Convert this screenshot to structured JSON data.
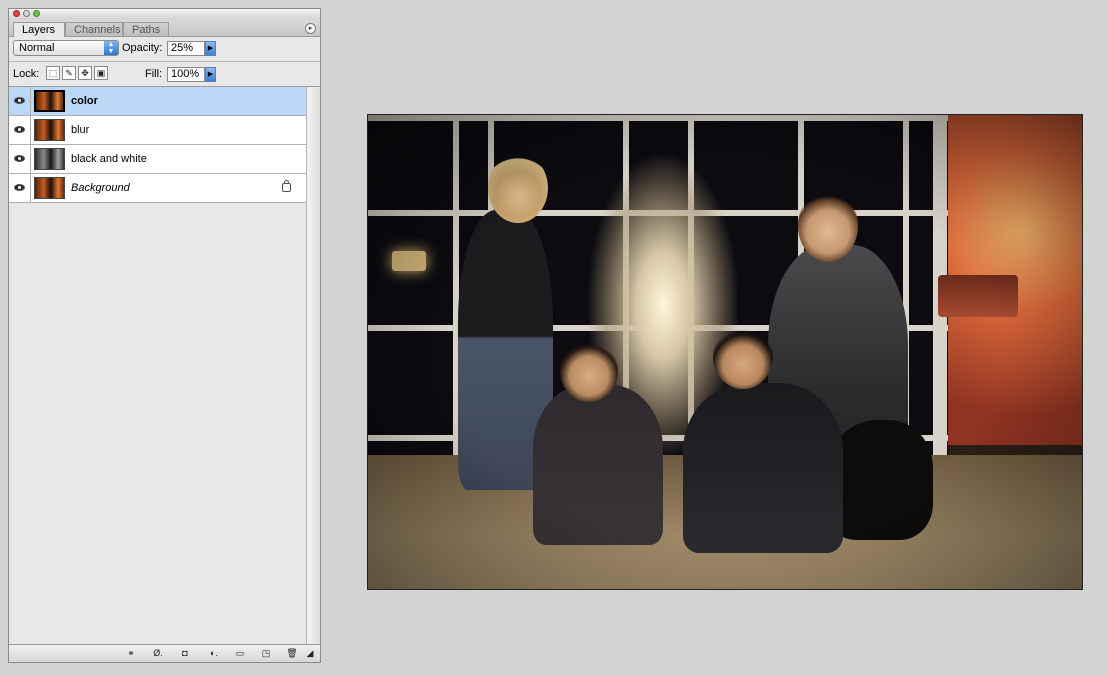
{
  "layers_panel": {
    "tabs": [
      "Layers",
      "Channels",
      "Paths"
    ],
    "blend_mode": "Normal",
    "opacity_label": "Opacity:",
    "opacity_value": "25%",
    "lock_label": "Lock:",
    "fill_label": "Fill:",
    "fill_value": "100%",
    "layers": [
      {
        "name": "color",
        "visible": true,
        "selected": true
      },
      {
        "name": "blur",
        "visible": true,
        "selected": false
      },
      {
        "name": "black and white",
        "visible": true,
        "selected": false
      },
      {
        "name": "Background",
        "visible": true,
        "selected": false,
        "locked": true
      }
    ],
    "bottom_icons": [
      "link-layers-icon",
      "layer-style-icon",
      "layer-mask-icon",
      "adjustment-layer-icon",
      "new-group-icon",
      "new-layer-icon",
      "trash-icon"
    ]
  },
  "canvas": {
    "selection_color": "#bcd8f7"
  }
}
